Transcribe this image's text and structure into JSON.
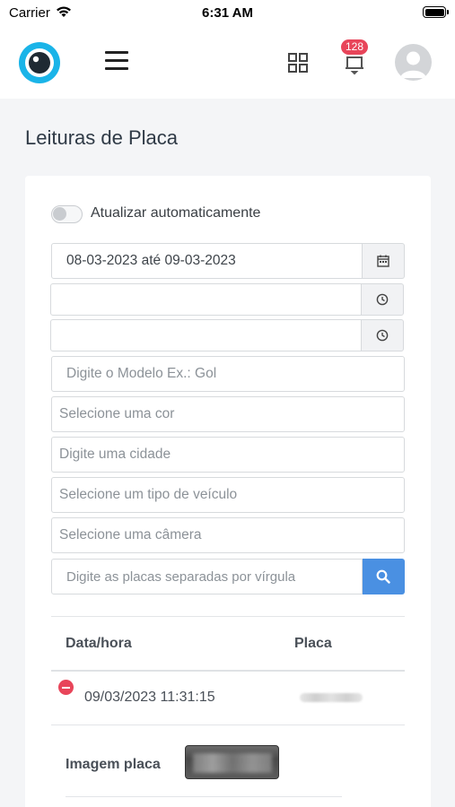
{
  "status_bar": {
    "carrier": "Carrier",
    "time": "6:31 AM"
  },
  "header": {
    "notification_count": "128",
    "accent_color": "#1ab4e8",
    "badge_color": "#e8455a"
  },
  "page": {
    "title": "Leituras de Placa"
  },
  "filters": {
    "auto_refresh_label": "Atualizar automaticamente",
    "auto_refresh_on": false,
    "date_range": "08-03-2023 até 09-03-2023",
    "start_time": "",
    "end_time": "",
    "model_placeholder": "Digite o Modelo Ex.: Gol",
    "color_placeholder": "Selecione uma cor",
    "city_placeholder": "Digite uma cidade",
    "vehicle_type_placeholder": "Selecione um tipo de veículo",
    "camera_placeholder": "Selecione uma câmera",
    "plates_placeholder": "Digite as placas separadas por vírgula",
    "search_button_color": "#4a90e2"
  },
  "table": {
    "headers": {
      "datetime": "Data/hora",
      "plate": "Placa"
    },
    "rows": [
      {
        "datetime": "09/03/2023 11:31:15",
        "plate": "",
        "image_label": "Imagem placa"
      }
    ]
  }
}
